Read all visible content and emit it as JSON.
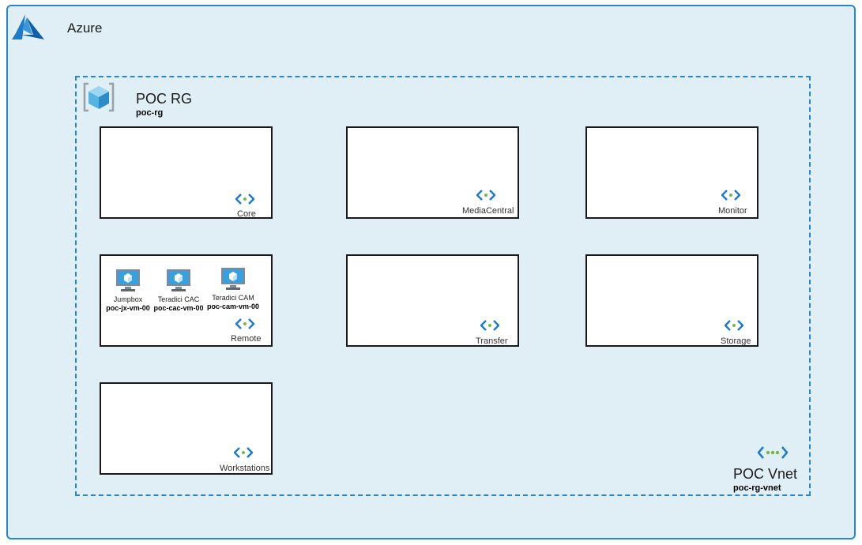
{
  "azure": {
    "label": "Azure",
    "icon": "azure-logo-icon"
  },
  "resource_group": {
    "title": "POC RG",
    "id": "poc-rg",
    "icon": "resource-group-cube-icon"
  },
  "vnet": {
    "title": "POC Vnet",
    "id": "poc-rg-vnet",
    "icon": "virtual-network-icon"
  },
  "subnets": [
    {
      "label": "Core"
    },
    {
      "label": "MediaCentral"
    },
    {
      "label": "Monitor"
    },
    {
      "label": "Remote"
    },
    {
      "label": "Transfer"
    },
    {
      "label": "Storage"
    },
    {
      "label": "Workstations"
    }
  ],
  "vms": [
    {
      "name": "Jumpbox",
      "id": "poc-jx-vm-00"
    },
    {
      "name": "Teradici CAC",
      "id": "poc-cac-vm-00"
    },
    {
      "name": "Teradici CAM",
      "id": "poc-cam-vm-00"
    }
  ],
  "colors": {
    "azure_blue": "#2a86c9",
    "frame_fill": "#e0eef6",
    "dot_green": "#7ab648"
  }
}
